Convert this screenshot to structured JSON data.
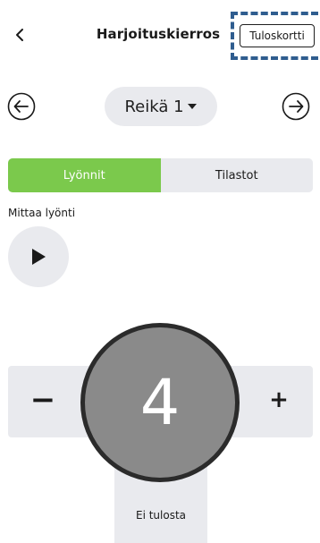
{
  "header": {
    "title": "Harjoituskierros",
    "scorecard_label": "Tuloskortti",
    "back_icon": "chevron-left-icon"
  },
  "hole_nav": {
    "selected_hole": "Reikä 1",
    "prev_icon": "arrow-left-circle-icon",
    "next_icon": "arrow-right-circle-icon"
  },
  "tabs": [
    {
      "label": "Lyönnit",
      "active": true
    },
    {
      "label": "Tilastot",
      "active": false
    }
  ],
  "measure": {
    "label": "Mittaa lyönti",
    "play_icon": "play-icon"
  },
  "stepper": {
    "minus_label": "−",
    "plus_label": "+",
    "value": "4",
    "no_result_label": "Ei tulosta"
  },
  "colors": {
    "accent_green": "#7bc94c",
    "highlight_blue": "#2f5d8f",
    "surface_gray": "#e9eaee",
    "score_circle": "#8a8a8a"
  }
}
